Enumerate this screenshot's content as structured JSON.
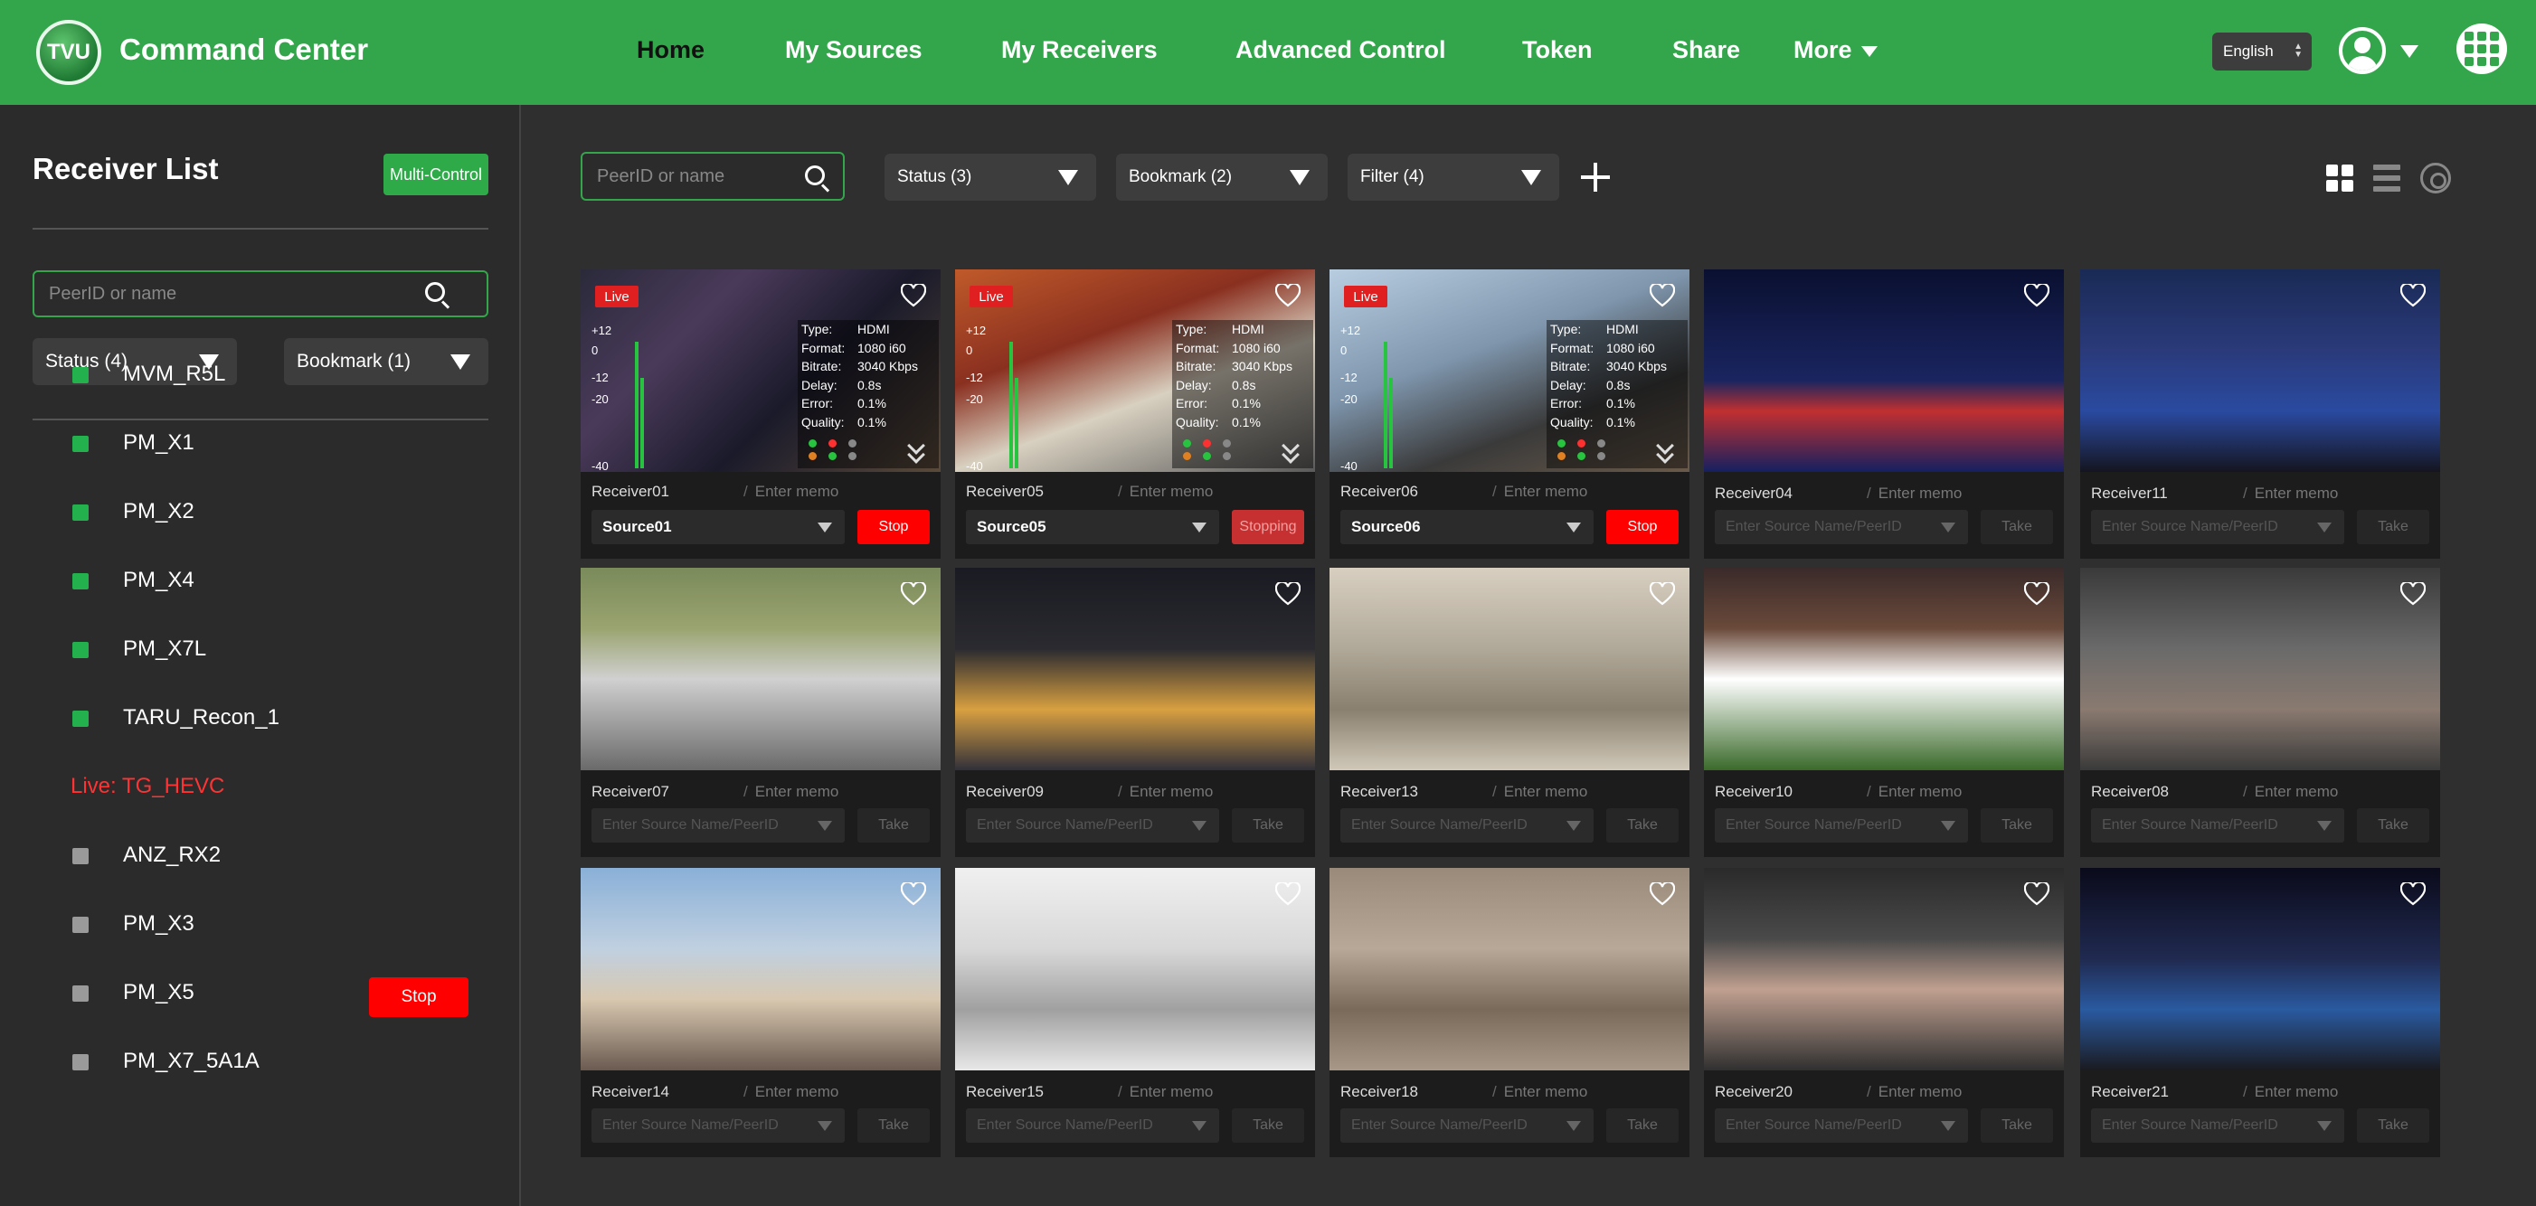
{
  "header": {
    "logo_text": "TVU",
    "title": "Command Center",
    "nav": [
      "Home",
      "My Sources",
      "My Receivers",
      "Advanced Control",
      "Token",
      "Share",
      "More"
    ],
    "language": "English"
  },
  "sidebar": {
    "title": "Receiver List",
    "multi_control": "Multi-Control",
    "search_placeholder": "PeerID or name",
    "status_filter": "Status (4)",
    "bookmark_filter": "Bookmark (1)",
    "items": [
      {
        "name": "MVM_R5L",
        "state": "online"
      },
      {
        "name": "PM_X1",
        "state": "online"
      },
      {
        "name": "PM_X2",
        "state": "online"
      },
      {
        "name": "PM_X4",
        "state": "online"
      },
      {
        "name": "PM_X7L",
        "state": "online"
      },
      {
        "name": "TARU_Recon_1",
        "state": "online"
      },
      {
        "name": "Live: TG_HEVC",
        "state": "live"
      },
      {
        "name": "ANZ_RX2",
        "state": "offline"
      },
      {
        "name": "PM_X3",
        "state": "offline"
      },
      {
        "name": "PM_X5",
        "state": "offline"
      },
      {
        "name": "PM_X7_5A1A",
        "state": "offline"
      }
    ],
    "stop_label": "Stop",
    "colors": {
      "online": "#22b14c",
      "offline": "#9a9a9a",
      "live": "#ff3333"
    }
  },
  "toolbar": {
    "search_placeholder": "PeerID or name",
    "status_filter": "Status (3)",
    "bookmark_filter": "Bookmark (2)",
    "filter": "Filter (4)"
  },
  "meter_labels": [
    "+12",
    "0",
    "-12",
    "-20",
    "-40"
  ],
  "stat_keys": [
    "Type:",
    "Format:",
    "Bitrate:",
    "Delay:",
    "Error:",
    "Quality:"
  ],
  "tiles": [
    {
      "receiver": "Receiver01",
      "memo": "Enter memo",
      "source": "Source01",
      "action": "Stop",
      "live": true,
      "stats": [
        "HDMI",
        "1080 i60",
        "3040 Kbps",
        "0.8s",
        "0.1%",
        "0.1%"
      ]
    },
    {
      "receiver": "Receiver05",
      "memo": "Enter memo",
      "source": "Source05",
      "action": "Stopping",
      "live": true,
      "stats": [
        "HDMI",
        "1080 i60",
        "3040 Kbps",
        "0.8s",
        "0.1%",
        "0.1%"
      ]
    },
    {
      "receiver": "Receiver06",
      "memo": "Enter memo",
      "source": "Source06",
      "action": "Stop",
      "live": true,
      "stats": [
        "HDMI",
        "1080 i60",
        "3040 Kbps",
        "0.8s",
        "0.1%",
        "0.1%"
      ]
    },
    {
      "receiver": "Receiver04",
      "memo": "Enter memo",
      "source": "Enter Source Name/PeerID",
      "action": "Take",
      "live": false
    },
    {
      "receiver": "Receiver11",
      "memo": "Enter memo",
      "source": "Enter Source Name/PeerID",
      "action": "Take",
      "live": false
    },
    {
      "receiver": "Receiver07",
      "memo": "Enter memo",
      "source": "Enter Source Name/PeerID",
      "action": "Take",
      "live": false
    },
    {
      "receiver": "Receiver09",
      "memo": "Enter memo",
      "source": "Enter Source Name/PeerID",
      "action": "Take",
      "live": false
    },
    {
      "receiver": "Receiver13",
      "memo": "Enter memo",
      "source": "Enter Source Name/PeerID",
      "action": "Take",
      "live": false
    },
    {
      "receiver": "Receiver10",
      "memo": "Enter memo",
      "source": "Enter Source Name/PeerID",
      "action": "Take",
      "live": false
    },
    {
      "receiver": "Receiver08",
      "memo": "Enter memo",
      "source": "Enter Source Name/PeerID",
      "action": "Take",
      "live": false
    },
    {
      "receiver": "Receiver14",
      "memo": "Enter memo",
      "source": "Enter Source Name/PeerID",
      "action": "Take",
      "live": false
    },
    {
      "receiver": "Receiver15",
      "memo": "Enter memo",
      "source": "Enter Source Name/PeerID",
      "action": "Take",
      "live": false
    },
    {
      "receiver": "Receiver18",
      "memo": "Enter memo",
      "source": "Enter Source Name/PeerID",
      "action": "Take",
      "live": false
    },
    {
      "receiver": "Receiver20",
      "memo": "Enter memo",
      "source": "Enter Source Name/PeerID",
      "action": "Take",
      "live": false
    },
    {
      "receiver": "Receiver21",
      "memo": "Enter memo",
      "source": "Enter Source Name/PeerID",
      "action": "Take",
      "live": false
    }
  ],
  "colors": {
    "brand": "#33a64b",
    "stop": "#ff0000",
    "background": "#2f2f2f",
    "tile": "#1c1c1c"
  }
}
